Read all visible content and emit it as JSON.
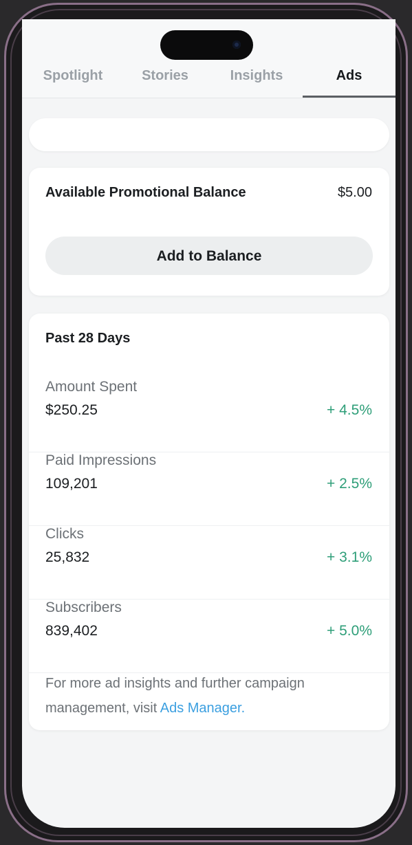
{
  "tabs": [
    {
      "label": "Spotlight",
      "active": false
    },
    {
      "label": "Stories",
      "active": false
    },
    {
      "label": "Insights",
      "active": false
    },
    {
      "label": "Ads",
      "active": true
    }
  ],
  "balance": {
    "label": "Available Promotional Balance",
    "value": "$5.00",
    "button_label": "Add to Balance"
  },
  "stats": {
    "title": "Past 28 Days",
    "rows": [
      {
        "label": "Amount Spent",
        "value": "$250.25",
        "change": "+ 4.5%"
      },
      {
        "label": "Paid Impressions",
        "value": "109,201",
        "change": "+ 2.5%"
      },
      {
        "label": "Clicks",
        "value": "25,832",
        "change": "+ 3.1%"
      },
      {
        "label": "Subscribers",
        "value": "839,402",
        "change": "+ 5.0%"
      }
    ],
    "footer_text": "For more ad insights and further campaign management, visit ",
    "footer_link": "Ads Manager."
  },
  "colors": {
    "positive_change": "#2e9e78",
    "link": "#3b9fe0",
    "frame_accent": "#8a6f88"
  }
}
